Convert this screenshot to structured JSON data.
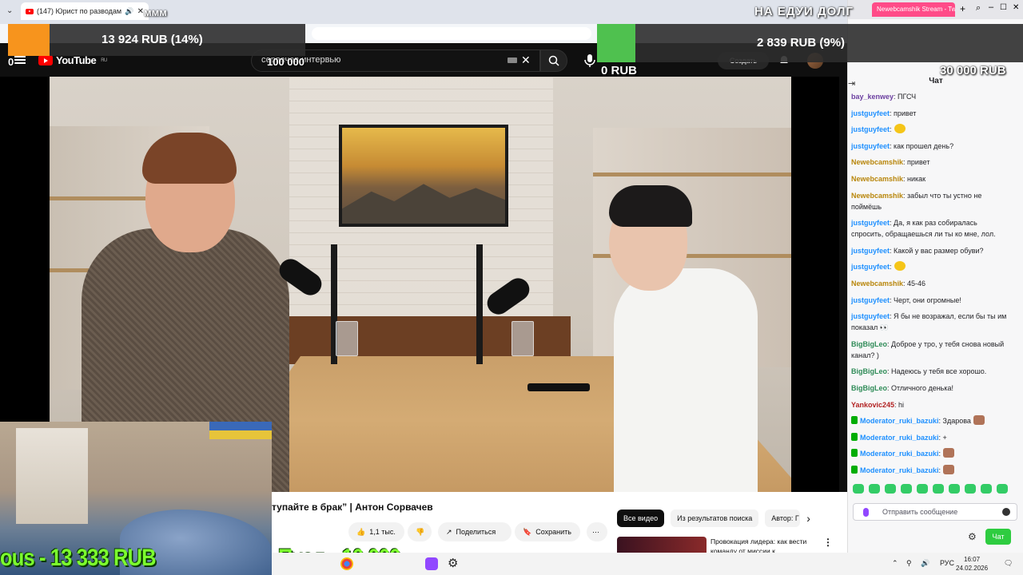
{
  "browser": {
    "tab_title": "(147) Юрист по разводам..."
  },
  "youtube": {
    "logo_text": "YouTube",
    "logo_region": "RU",
    "search_value": "сорвачев интервью",
    "create_label": "Создать",
    "video_title": "тупайте в брак” | Антон Сорвачев",
    "likes": "1,1 тыс.",
    "share_label": "Поделиться",
    "save_label": "Сохранить",
    "filters": [
      "Все видео",
      "Из результатов поиска",
      "Автор: Г"
    ],
    "reco_title": "Провокация лидера: как вести команду от миссии к..."
  },
  "chat": {
    "tab_title": "Newebcamshik Stream - Tw",
    "header": "Чат",
    "messages": [
      {
        "user": "bay_kenwey",
        "text": ": ПГСЧ",
        "color": "#6b3fa0",
        "badge": "",
        "emote": ""
      },
      {
        "user": "justguyfeet",
        "text": ": привет",
        "color": "#1e90ff",
        "badge": "",
        "emote": ""
      },
      {
        "user": "justguyfeet",
        "text": ":",
        "color": "#1e90ff",
        "badge": "",
        "emote": "emote"
      },
      {
        "user": "justguyfeet",
        "text": ": как прошел день?",
        "color": "#1e90ff",
        "badge": "",
        "emote": ""
      },
      {
        "user": "Newebcamshik",
        "text": ": привет",
        "color": "#b8860b",
        "badge": "mic",
        "emote": ""
      },
      {
        "user": "Newebcamshik",
        "text": ": никак",
        "color": "#b8860b",
        "badge": "mic",
        "emote": ""
      },
      {
        "user": "Newebcamshik",
        "text": ": забыл что ты устно не поймёшь",
        "color": "#b8860b",
        "badge": "mic",
        "emote": ""
      },
      {
        "user": "justguyfeet",
        "text": ": Да, я как раз собиралась спросить, обращаешься ли ты ко мне, лол.",
        "color": "#1e90ff",
        "badge": "",
        "emote": ""
      },
      {
        "user": "justguyfeet",
        "text": ": Какой у вас размер обуви?",
        "color": "#1e90ff",
        "badge": "",
        "emote": ""
      },
      {
        "user": "justguyfeet",
        "text": ":",
        "color": "#1e90ff",
        "badge": "",
        "emote": "emote"
      },
      {
        "user": "Newebcamshik",
        "text": ": 45-46",
        "color": "#b8860b",
        "badge": "mic",
        "emote": ""
      },
      {
        "user": "justguyfeet",
        "text": ": Черт, они огромные!",
        "color": "#1e90ff",
        "badge": "",
        "emote": ""
      },
      {
        "user": "justguyfeet",
        "text": ": Я бы не возражал, если бы ты им показал 👀",
        "color": "#1e90ff",
        "badge": "",
        "emote": ""
      },
      {
        "user": "BigBigLeo",
        "text": ": Доброе у тро, у тебя снова новый канал? )",
        "color": "#2e8b57",
        "badge": "",
        "emote": ""
      },
      {
        "user": "BigBigLeo",
        "text": ": Надеюсь у тебя все хорошо.",
        "color": "#2e8b57",
        "badge": "",
        "emote": ""
      },
      {
        "user": "BigBigLeo",
        "text": ": Отличного денька!",
        "color": "#2e8b57",
        "badge": "",
        "emote": ""
      },
      {
        "user": "Yankovic245",
        "text": ": hi",
        "color": "#b22222",
        "badge": "",
        "emote": ""
      },
      {
        "user": "Moderator_ruki_bazuki",
        "text": ": Здарова",
        "color": "#1e90ff",
        "badge": "mod",
        "emote": "face"
      },
      {
        "user": "Moderator_ruki_bazuki",
        "text": ": +",
        "color": "#1e90ff",
        "badge": "mod",
        "emote": ""
      },
      {
        "user": "Moderator_ruki_bazuki",
        "text": ":",
        "color": "#1e90ff",
        "badge": "mod",
        "emote": "face"
      },
      {
        "user": "Moderator_ruki_bazuki",
        "text": ":",
        "color": "#1e90ff",
        "badge": "mod",
        "emote": "face"
      }
    ],
    "input_placeholder": "Отправить сообщение",
    "send_label": "Чат"
  },
  "overlays": {
    "goal_left": {
      "text": "13 924 RUB (14%)",
      "fill_pct": 14,
      "color": "#f7941d"
    },
    "goal_right": {
      "text": "2 839 RUB (9%)",
      "fill_pct": 9,
      "color": "#4fc14f"
    },
    "goal_right_start": "0 RUB",
    "goal_right_target": "30 000 RUB",
    "goal_left_start": "100 000",
    "top_caption": "НА ЕДУИ ДОЛГ",
    "top_left_caption": "ммм",
    "bottom_left": "ous - 13 333 RUB",
    "bottom_mid": "Пуол - 10 000",
    "corner_zero": "0"
  },
  "taskbar": {
    "lang": "РУС",
    "time": "16:07",
    "date": "24.02.2026"
  }
}
